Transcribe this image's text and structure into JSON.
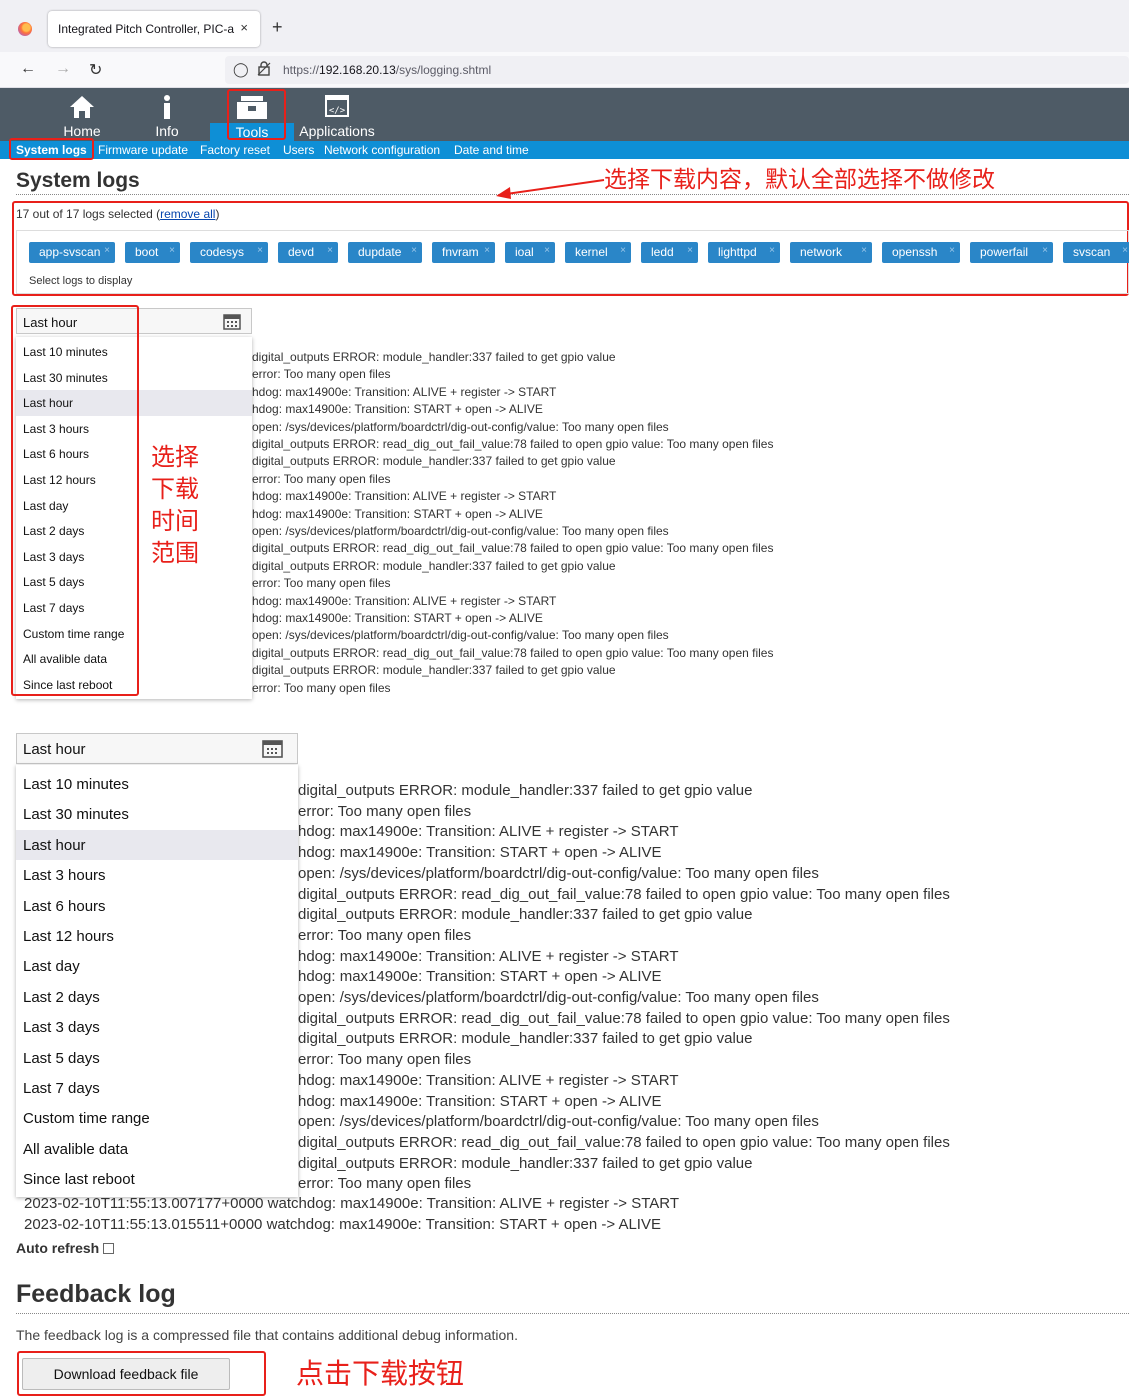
{
  "browser": {
    "tab_title": "Integrated Pitch Controller, PIC-a",
    "tab_close": "×",
    "new_tab": "+",
    "url_prefix": "https://",
    "url_host": "192.168.20.13",
    "url_path": "/sys/logging.shtml"
  },
  "main_nav": [
    {
      "label": "Home",
      "icon": "home-icon"
    },
    {
      "label": "Info",
      "icon": "info-icon"
    },
    {
      "label": "Tools",
      "icon": "toolbox-icon"
    },
    {
      "label": "Applications",
      "icon": "code-icon"
    }
  ],
  "sub_nav": [
    "System logs",
    "Firmware update",
    "Factory reset",
    "Users",
    "Network configuration",
    "Date and time"
  ],
  "system_logs": {
    "title": "System logs",
    "selected_text": "17 out of 17 logs selected (",
    "remove_all": "remove all",
    "selected_close": ")",
    "chips": [
      "app-svscan",
      "boot",
      "codesys",
      "devd",
      "dupdate",
      "fnvram",
      "ioal",
      "kernel",
      "ledd",
      "lighttpd",
      "network",
      "openssh",
      "powerfail",
      "svscan"
    ],
    "hint": "Select logs to display"
  },
  "time_range": {
    "current": "Last hour",
    "options": [
      "Last 10 minutes",
      "Last 30 minutes",
      "Last hour",
      "Last 3 hours",
      "Last 6 hours",
      "Last 12 hours",
      "Last day",
      "Last 2 days",
      "Last 3 days",
      "Last 5 days",
      "Last 7 days",
      "Custom time range",
      "All avalible data",
      "Since last reboot"
    ],
    "selected_index": 2
  },
  "log_lines": [
    "digital_outputs ERROR:  module_handler:337 failed to get gpio value",
    "error: Too many open files",
    "hdog: max14900e: Transition: ALIVE + register -> START",
    "hdog: max14900e: Transition: START + open -> ALIVE",
    "open: /sys/devices/platform/boardctrl/dig-out-config/value: Too many open files",
    "digital_outputs ERROR:  read_dig_out_fail_value:78 failed to open gpio value: Too many open files",
    "digital_outputs ERROR:  module_handler:337 failed to get gpio value",
    "error: Too many open files",
    "hdog: max14900e: Transition: ALIVE + register -> START",
    "hdog: max14900e: Transition: START + open -> ALIVE",
    "open: /sys/devices/platform/boardctrl/dig-out-config/value: Too many open files",
    "digital_outputs ERROR:  read_dig_out_fail_value:78 failed to open gpio value: Too many open files",
    "digital_outputs ERROR:  module_handler:337 failed to get gpio value",
    "error: Too many open files",
    "hdog: max14900e: Transition: ALIVE + register -> START",
    "hdog: max14900e: Transition: START + open -> ALIVE",
    "open: /sys/devices/platform/boardctrl/dig-out-config/value: Too many open files",
    "digital_outputs ERROR:  read_dig_out_fail_value:78 failed to open gpio value: Too many open files",
    "digital_outputs ERROR:  module_handler:337 failed to get gpio value",
    "error: Too many open files"
  ],
  "log_tail": [
    "2023-02-10T11:55:13.007177+0000 watchdog: max14900e: Transition: ALIVE + register -> START",
    "2023-02-10T11:55:13.015511+0000 watchdog: max14900e: Transition: START + open -> ALIVE"
  ],
  "auto_refresh": "Auto refresh",
  "feedback": {
    "title": "Feedback log",
    "description": "The feedback log is a compressed file that contains additional debug information.",
    "button": "Download feedback file"
  },
  "annotations": {
    "select_content": "选择下载内容，默认全部选择不做修改",
    "select_time_lines": [
      "选择",
      "下载",
      "时间",
      "范围"
    ],
    "click_download": "点击下载按钮"
  },
  "colors": {
    "accent": "#0e8fd6",
    "header": "#4e5b66",
    "chip": "#2a86c8",
    "annotation": "#e8201a"
  }
}
